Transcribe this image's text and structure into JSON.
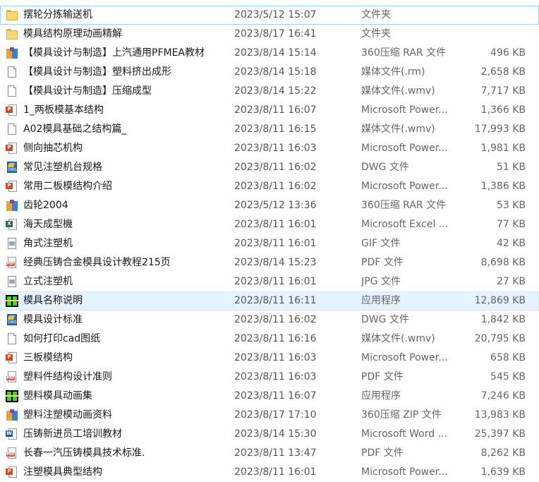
{
  "files": [
    {
      "name": "摆轮分拣输送机",
      "date": "2023/5/12 15:07",
      "type": "文件夹",
      "size": "",
      "icon": "folder-icon",
      "state": "focus"
    },
    {
      "name": "模具结构原理动画精解",
      "date": "2023/8/17 16:41",
      "type": "文件夹",
      "size": "",
      "icon": "folder-icon",
      "state": ""
    },
    {
      "name": "【模具设计与制造】上汽通用PFMEA教材",
      "date": "2023/8/14 15:14",
      "type": "360压缩 RAR 文件",
      "size": "496 KB",
      "icon": "rar-archive-icon",
      "state": ""
    },
    {
      "name": "【模具设计与制造】塑料挤出成形",
      "date": "2023/8/14 15:18",
      "type": "媒体文件(.rm)",
      "size": "2,658 KB",
      "icon": "media-file-icon",
      "state": ""
    },
    {
      "name": "【模具设计与制造】压缩成型",
      "date": "2023/8/14 15:22",
      "type": "媒体文件(.wmv)",
      "size": "7,717 KB",
      "icon": "media-file-icon",
      "state": ""
    },
    {
      "name": "1_两板模基本结构",
      "date": "2023/8/11 16:07",
      "type": "Microsoft Power...",
      "size": "1,366 KB",
      "icon": "powerpoint-icon",
      "state": ""
    },
    {
      "name": "A02模具基础之结构篇_",
      "date": "2023/8/11 16:15",
      "type": "媒体文件(.wmv)",
      "size": "17,993 KB",
      "icon": "media-file-icon",
      "state": ""
    },
    {
      "name": "侧向抽芯机构",
      "date": "2023/8/11 16:03",
      "type": "Microsoft Power...",
      "size": "1,981 KB",
      "icon": "powerpoint-icon",
      "state": ""
    },
    {
      "name": "常见注塑机台规格",
      "date": "2023/8/11 16:02",
      "type": "DWG 文件",
      "size": "51 KB",
      "icon": "dwg-file-icon",
      "state": ""
    },
    {
      "name": "常用二板模结构介绍",
      "date": "2023/8/11 16:02",
      "type": "Microsoft Power...",
      "size": "1,386 KB",
      "icon": "powerpoint-icon",
      "state": ""
    },
    {
      "name": "齿轮2004",
      "date": "2023/5/12 13:36",
      "type": "360压缩 RAR 文件",
      "size": "53 KB",
      "icon": "rar-archive-icon",
      "state": ""
    },
    {
      "name": "海天成型機",
      "date": "2023/8/11 16:01",
      "type": "Microsoft Excel ...",
      "size": "77 KB",
      "icon": "excel-icon",
      "state": ""
    },
    {
      "name": "角式注塑机",
      "date": "2023/8/11 16:01",
      "type": "GIF 文件",
      "size": "42 KB",
      "icon": "gif-image-icon",
      "state": ""
    },
    {
      "name": "经典压铸合金模具设计教程215页",
      "date": "2023/8/14 15:23",
      "type": "PDF 文件",
      "size": "8,698 KB",
      "icon": "pdf-icon",
      "state": ""
    },
    {
      "name": "立式注塑机",
      "date": "2023/8/11 16:01",
      "type": "JPG 文件",
      "size": "27 KB",
      "icon": "jpg-image-icon",
      "state": ""
    },
    {
      "name": "模具名称说明",
      "date": "2023/8/11 16:11",
      "type": "应用程序",
      "size": "12,869 KB",
      "icon": "application-icon",
      "state": "hover"
    },
    {
      "name": "模具设计标准",
      "date": "2023/8/11 16:02",
      "type": "DWG 文件",
      "size": "1,842 KB",
      "icon": "dwg-file-icon",
      "state": ""
    },
    {
      "name": "如何打印cad图纸",
      "date": "2023/8/11 16:16",
      "type": "媒体文件(.wmv)",
      "size": "20,795 KB",
      "icon": "media-file-icon",
      "state": ""
    },
    {
      "name": "三板模结构",
      "date": "2023/8/11 16:03",
      "type": "Microsoft Power...",
      "size": "658 KB",
      "icon": "powerpoint-icon",
      "state": ""
    },
    {
      "name": "塑料件结构设计准则",
      "date": "2023/8/11 16:03",
      "type": "PDF 文件",
      "size": "545 KB",
      "icon": "pdf-icon",
      "state": ""
    },
    {
      "name": "塑料模具动画集",
      "date": "2023/8/11 16:07",
      "type": "应用程序",
      "size": "7,246 KB",
      "icon": "application-icon",
      "state": ""
    },
    {
      "name": "塑料注塑模动画资料",
      "date": "2023/8/17 17:10",
      "type": "360压缩 ZIP 文件",
      "size": "13,983 KB",
      "icon": "zip-archive-icon",
      "state": ""
    },
    {
      "name": "压铸新进员工培训教材",
      "date": "2023/8/14 15:30",
      "type": "Microsoft Word ...",
      "size": "25,397 KB",
      "icon": "word-icon",
      "state": ""
    },
    {
      "name": "长春一汽压铸模具技术标准.",
      "date": "2023/8/11 13:47",
      "type": "PDF 文件",
      "size": "8,262 KB",
      "icon": "pdf-icon",
      "state": ""
    },
    {
      "name": "注塑模具典型结构",
      "date": "2023/8/11 16:01",
      "type": "Microsoft Power...",
      "size": "1,639 KB",
      "icon": "powerpoint-icon",
      "state": ""
    }
  ],
  "colors": {
    "hover_bg": "#e5f3ff",
    "focus_border": "#99d1ff"
  }
}
